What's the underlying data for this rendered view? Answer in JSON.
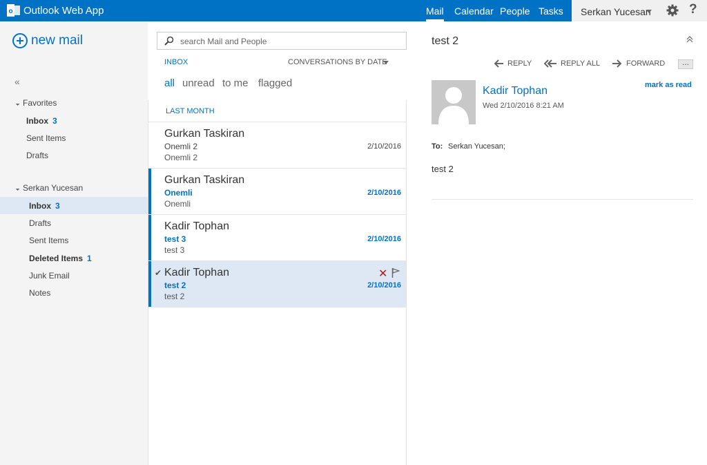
{
  "app": {
    "title": "Outlook Web App"
  },
  "nav": {
    "mail": "Mail",
    "calendar": "Calendar",
    "people": "People",
    "tasks": "Tasks"
  },
  "user": {
    "name": "Serkan Yucesan",
    "help": "?"
  },
  "sidebar": {
    "new_mail": "new mail",
    "collapse": "«",
    "favorites": {
      "label": "Favorites",
      "items": [
        {
          "label": "Inbox",
          "count": "3"
        },
        {
          "label": "Sent Items",
          "count": ""
        },
        {
          "label": "Drafts",
          "count": ""
        }
      ]
    },
    "account": {
      "label": "Serkan Yucesan",
      "items": [
        {
          "label": "Inbox",
          "count": "3"
        },
        {
          "label": "Drafts",
          "count": ""
        },
        {
          "label": "Sent Items",
          "count": ""
        },
        {
          "label": "Deleted Items",
          "count": "1"
        },
        {
          "label": "Junk Email",
          "count": ""
        },
        {
          "label": "Notes",
          "count": ""
        }
      ]
    }
  },
  "list": {
    "search_placeholder": "search Mail and People",
    "folder": "INBOX",
    "sort": "CONVERSATIONS BY DATE",
    "filters": [
      "all",
      "unread",
      "to me",
      "flagged"
    ],
    "group_label": "LAST MONTH",
    "messages": [
      {
        "sender": "Gurkan Taskiran",
        "subject": "Onemli 2",
        "preview": "Onemli 2",
        "date": "2/10/2016",
        "unread": false,
        "selected": false
      },
      {
        "sender": "Gurkan Taskiran",
        "subject": "Onemli",
        "preview": "Onemli",
        "date": "2/10/2016",
        "unread": true,
        "selected": false
      },
      {
        "sender": "Kadir Tophan",
        "subject": "test 3",
        "preview": "test 3",
        "date": "2/10/2016",
        "unread": true,
        "selected": false
      },
      {
        "sender": "Kadir Tophan",
        "subject": "test 2",
        "preview": "test 2",
        "date": "2/10/2016",
        "unread": true,
        "selected": true
      }
    ]
  },
  "reading": {
    "title": "test 2",
    "actions": {
      "reply": "REPLY",
      "reply_all": "REPLY ALL",
      "forward": "FORWARD"
    },
    "more": "...",
    "from_name": "Kadir Tophan",
    "date": "Wed 2/10/2016 8:21 AM",
    "mark_as_read": "mark as read",
    "to_label": "To:",
    "to_value": "Serkan Yucesan;",
    "body": "test 2"
  },
  "colors": {
    "accent": "#0072c6",
    "selected_bg": "#dde8f4",
    "delete": "#b01a1a"
  }
}
